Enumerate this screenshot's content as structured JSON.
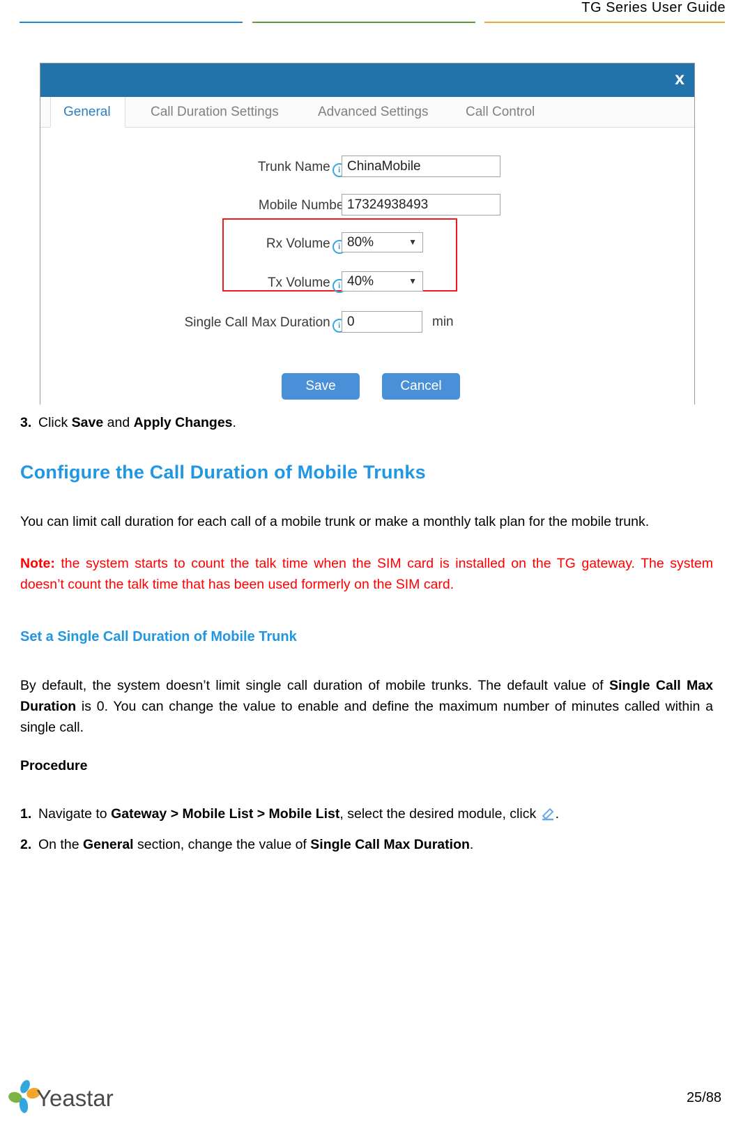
{
  "header": {
    "title": "TG Series User Guide",
    "rule_colors": {
      "blue": "#1f8ad0",
      "green": "#5d9c3d",
      "amber": "#e8a828"
    }
  },
  "dialog": {
    "close_label": "x",
    "titlebar_color": "#2272ab",
    "tabs": [
      {
        "label": "General",
        "active": true
      },
      {
        "label": "Call Duration Settings",
        "active": false
      },
      {
        "label": "Advanced Settings",
        "active": false
      },
      {
        "label": "Call Control",
        "active": false
      }
    ],
    "fields": {
      "trunk_name": {
        "label": "Trunk Name",
        "has_info": true,
        "colon": ":",
        "value": "ChinaMobile"
      },
      "mobile_number": {
        "label": "Mobile Number",
        "has_info": false,
        "colon": ":",
        "value": "17324938493"
      },
      "rx_volume": {
        "label": "Rx Volume",
        "has_info": true,
        "colon": ":",
        "value": "80%",
        "caret": "▼"
      },
      "tx_volume": {
        "label": "Tx Volume",
        "has_info": true,
        "colon": ":",
        "value": "40%",
        "caret": "▼"
      },
      "single_call_max_duration": {
        "label": "Single Call Max Duration",
        "has_info": true,
        "colon": ":",
        "value": "0",
        "unit": "min"
      }
    },
    "highlight_color": "#ee1c1c",
    "buttons": {
      "save": "Save",
      "cancel": "Cancel",
      "color": "#4a90d9"
    },
    "info_icon_glyph": "i"
  },
  "body": {
    "step3": {
      "number": "3.",
      "text_1": "Click ",
      "bold_1": "Save",
      "text_2": " and ",
      "bold_2": "Apply Changes",
      "text_3": "."
    },
    "section_heading": "Configure the Call Duration of Mobile Trunks",
    "intro_paragraph": "You can limit call duration for each call of a mobile trunk or make a monthly talk plan for the mobile trunk.",
    "note": {
      "label": "Note:",
      "text": " the system starts to count the talk time when the SIM card is installed on the TG gateway. The system doesn’t count the talk time that has been used formerly on the SIM card.",
      "color": "#ff0000"
    },
    "subsection_heading": "Set a Single Call Duration of Mobile Trunk",
    "description": {
      "text_1": "By default, the system doesn’t limit single call duration of mobile trunks. The default value of ",
      "bold_1": "Single Call Max Duration",
      "text_2": " is 0. You can change the value to enable and define the maximum number of minutes called within a single call."
    },
    "procedure_heading": "Procedure",
    "steps": [
      {
        "number": "1.",
        "text_1": "Navigate to ",
        "bold_1": "Gateway > Mobile List > Mobile List",
        "text_2": ", select the desired module, click ",
        "icon": "edit-pencil-icon",
        "text_3": "."
      },
      {
        "number": "2.",
        "text_1": "On the ",
        "bold_1": "General",
        "text_2": " section, change the value of ",
        "bold_2": "Single Call Max Duration",
        "text_3": "."
      }
    ]
  },
  "footer": {
    "brand": "Yeastar",
    "page_number": "25/88",
    "logo_colors": {
      "blue": "#33a7dd",
      "orange": "#f0a62a",
      "green": "#7cb342",
      "text": "#4a4a4a"
    }
  }
}
